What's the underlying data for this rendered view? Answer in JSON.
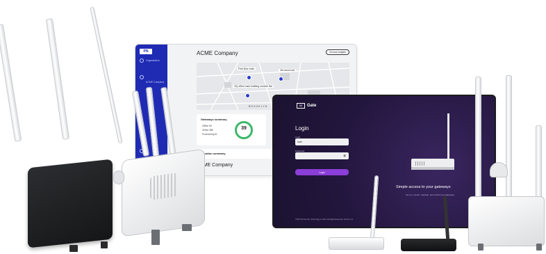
{
  "dashboard": {
    "logo": "PN",
    "title": "ACME Company",
    "change_button": "Choose widgets",
    "sidebar_items": [
      "Organisation",
      "ACME Company"
    ],
    "map_labels": [
      "First floor main",
      "3rd wood unit",
      "HQ office main building number five"
    ],
    "map_street": "BROOKLYN",
    "gateways_title": "Gateways summary",
    "gateways_rows": [
      "Offline 56",
      "Online 388",
      "Provisioning 61"
    ],
    "gateways_total": "39",
    "location_title": "Location summary",
    "company_title_2": "ACME Company"
  },
  "login": {
    "logo_box": "IW",
    "logo_text": "Gate",
    "title": "Login",
    "user_label": "Login",
    "user_value": "user",
    "password_label": "Password",
    "button": "Login",
    "tagline": "Simple access to your gateways",
    "tagline_sub": "Set up, monitor, maintain, and control your gateways",
    "footer": "©2023 IW Security Technology Limited. All Rights Reserved. Version 1.0"
  },
  "colors": {
    "sidebar": "#1f2bb3",
    "login_bg": "#23163e",
    "login_button": "#8b3ed8",
    "ring": "#39b86a"
  }
}
